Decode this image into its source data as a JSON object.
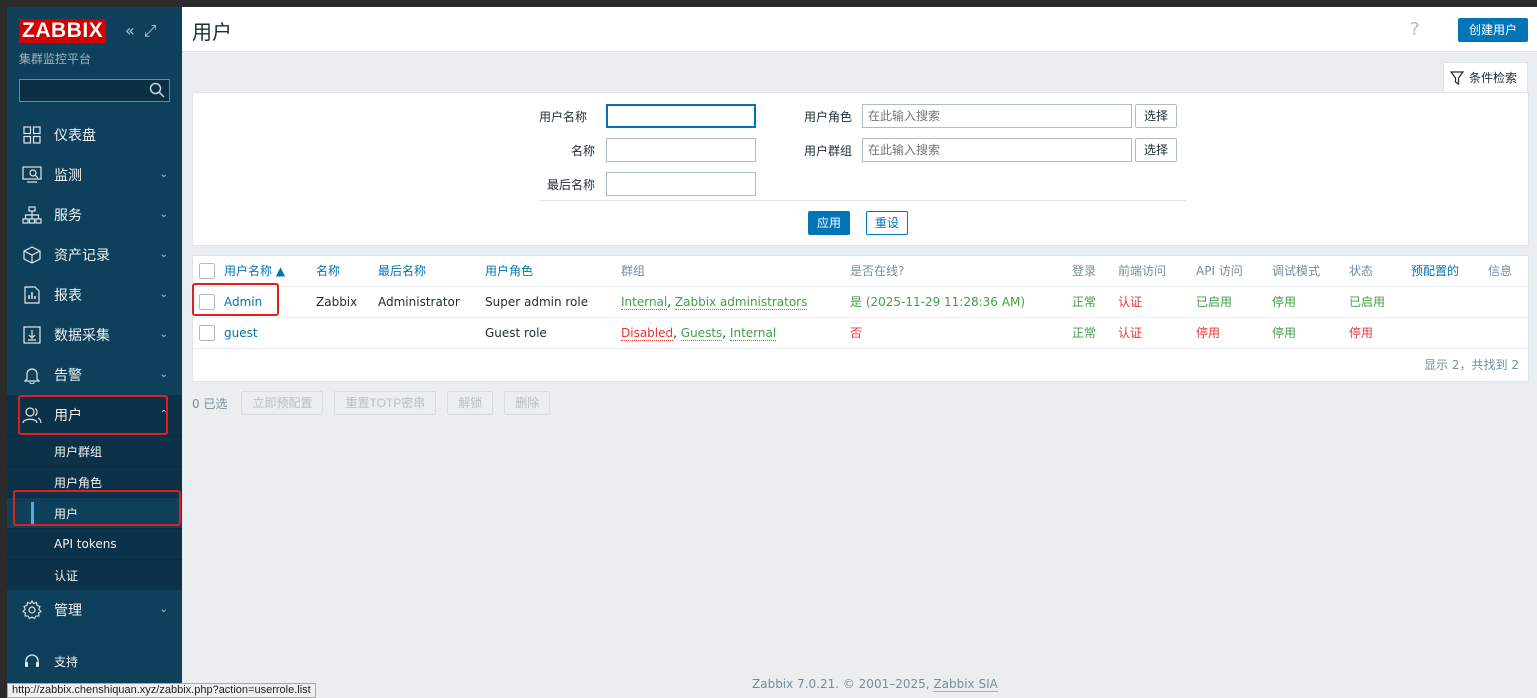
{
  "sidebar": {
    "logo": "ZABBIX",
    "subtitle": "集群监控平台",
    "search_value": "",
    "menu": [
      {
        "label": "仪表盘",
        "icon": "dashboard-icon"
      },
      {
        "label": "监测",
        "icon": "monitoring-icon"
      },
      {
        "label": "服务",
        "icon": "services-icon"
      },
      {
        "label": "资产记录",
        "icon": "inventory-icon"
      },
      {
        "label": "报表",
        "icon": "reports-icon"
      },
      {
        "label": "数据采集",
        "icon": "data-collection-icon"
      },
      {
        "label": "告警",
        "icon": "alerts-icon"
      },
      {
        "label": "用户",
        "icon": "users-icon"
      }
    ],
    "submenu": [
      "用户群组",
      "用户角色",
      "用户",
      "API tokens",
      "认证"
    ],
    "admin_label": "管理",
    "support_label": "支持"
  },
  "header": {
    "title": "用户",
    "help": "?",
    "create_button": "创建用户"
  },
  "filter": {
    "tab_label": "条件检索",
    "username_label": "用户名称",
    "name_label": "名称",
    "lastname_label": "最后名称",
    "role_label": "用户角色",
    "group_label": "用户群组",
    "role_placeholder": "在此输入搜索",
    "group_placeholder": "在此输入搜索",
    "select_button": "选择",
    "apply_button": "应用",
    "reset_button": "重设"
  },
  "table": {
    "headers": {
      "username": "用户名称 ▲",
      "name": "名称",
      "lastname": "最后名称",
      "role": "用户角色",
      "groups": "群组",
      "online": "是否在线?",
      "login": "登录",
      "frontend": "前端访问",
      "api": "API 访问",
      "debug": "调试模式",
      "status": "状态",
      "provisioned": "预配置的",
      "info": "信息"
    },
    "rows": [
      {
        "username": "Admin",
        "name": "Zabbix",
        "lastname": "Administrator",
        "role": "Super admin role",
        "groups": [
          "Internal",
          "Zabbix administrators"
        ],
        "online": "是 (2025-11-29 11:28:36 AM)",
        "login": "正常",
        "frontend": "认证",
        "api": "已启用",
        "debug": "停用",
        "status": "已启用"
      },
      {
        "username": "guest",
        "name": "",
        "lastname": "",
        "role": "Guest role",
        "groups": [
          "Disabled",
          "Guests",
          "Internal"
        ],
        "online": "否",
        "login": "正常",
        "frontend": "认证",
        "api": "停用",
        "debug": "停用",
        "status": "停用"
      }
    ],
    "summary": "显示 2，共找到 2",
    "group_sep": ", "
  },
  "actions": {
    "selected": "0 已选",
    "provision": "立即预配置",
    "reset_totp": "重置TOTP密串",
    "unblock": "解锁",
    "delete": "删除"
  },
  "footer": {
    "text": "Zabbix 7.0.21. © 2001–2025,",
    "link": "Zabbix SIA"
  },
  "statusbar": "http://zabbix.chenshiquan.xyz/zabbix.php?action=userrole.list",
  "colors": {
    "sidebar_bg": "#0f405b",
    "accent": "#0275b8",
    "brand_red": "#d40000",
    "ok_green": "#429e47",
    "alert_red": "#e33734",
    "highlight_box": "#e02020"
  }
}
